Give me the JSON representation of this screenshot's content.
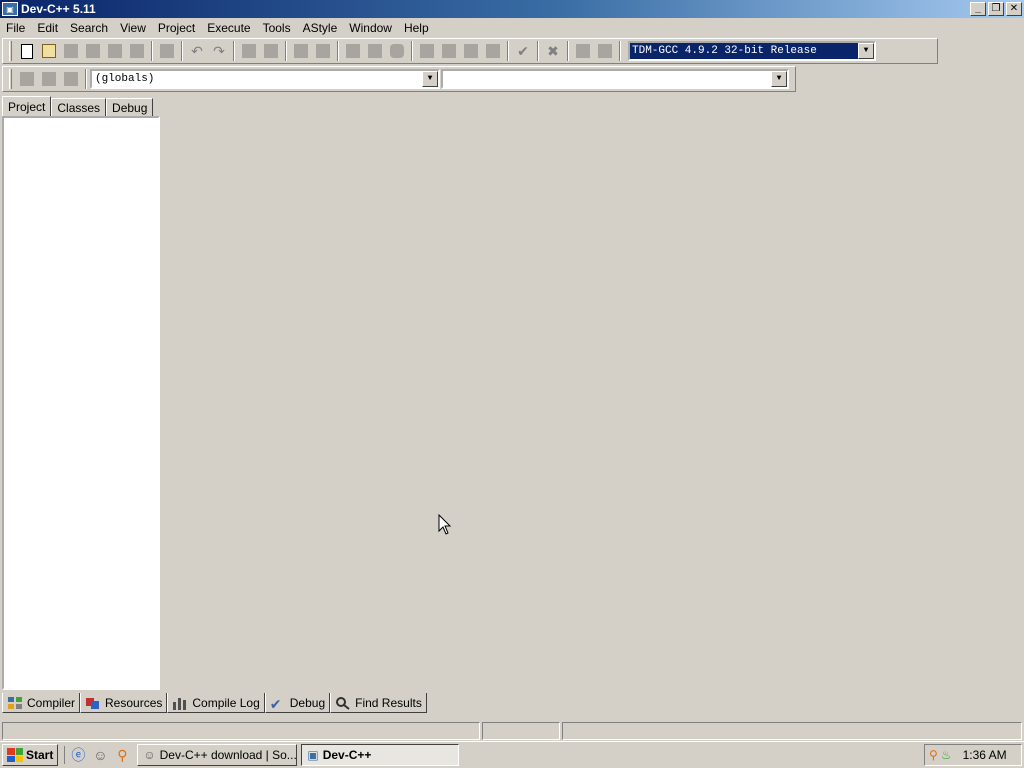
{
  "window": {
    "title": "Dev-C++ 5.11"
  },
  "title_controls": {
    "minimize": "_",
    "maximize": "❐",
    "close": "✕"
  },
  "menu": [
    {
      "label": "File"
    },
    {
      "label": "Edit"
    },
    {
      "label": "Search"
    },
    {
      "label": "View"
    },
    {
      "label": "Project"
    },
    {
      "label": "Execute"
    },
    {
      "label": "Tools"
    },
    {
      "label": "AStyle"
    },
    {
      "label": "Window"
    },
    {
      "label": "Help"
    }
  ],
  "toolbar": {
    "compiler_select_value": "TDM-GCC 4.9.2 32-bit Release",
    "dropdown_arrow": "▼"
  },
  "class_browser": {
    "scope_value": "(globals)",
    "member_value": ""
  },
  "left_tabs": [
    {
      "label": "Project"
    },
    {
      "label": "Classes"
    },
    {
      "label": "Debug"
    }
  ],
  "bottom_tabs": [
    {
      "label": "Compiler"
    },
    {
      "label": "Resources"
    },
    {
      "label": "Compile Log"
    },
    {
      "label": "Debug"
    },
    {
      "label": "Find Results"
    }
  ],
  "taskbar": {
    "start_label": "Start",
    "tasks": [
      {
        "label": "Dev-C++ download | So..."
      },
      {
        "label": "Dev-C++"
      }
    ],
    "clock": "1:36 AM"
  }
}
